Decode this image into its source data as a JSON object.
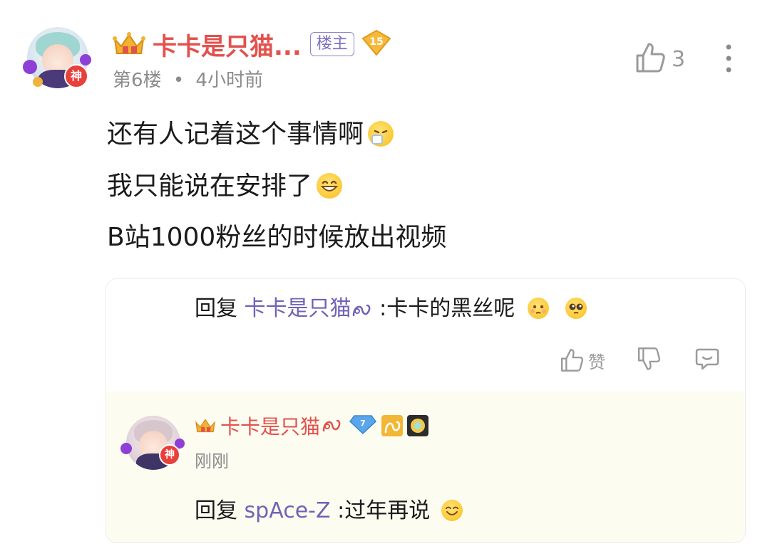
{
  "comment": {
    "username": "卡卡是只猫...",
    "op_badge": "楼主",
    "level": "15",
    "floor": "第6楼",
    "time_separator": "•",
    "time": "4小时前",
    "like_count": "3",
    "avatar_badge": "神",
    "lines": [
      "还有人记着这个事情啊",
      "我只能说在安排了",
      "B站1000粉丝的时候放出视频"
    ],
    "emoji_icons": [
      "sneezing-face-icon",
      "grinning-face-icon"
    ]
  },
  "replies": {
    "first": {
      "prefix": "回复 ",
      "mention": "卡卡是只猫",
      "mention_suffix_icon": "leo-icon",
      "colon_text": " :卡卡的黑丝呢",
      "emoji_icons": [
        "flushed-face-icon",
        "pleading-face-icon"
      ],
      "like_label": "赞"
    },
    "second": {
      "username": "卡卡是只猫",
      "username_suffix_icon": "leo-icon",
      "time": "刚刚",
      "level_badge": "7",
      "avatar_badge": "神",
      "prefix": "回复 ",
      "mention": "spAce-Z",
      "colon_text": " :过年再说",
      "emoji_icons": [
        "smiling-face-icon"
      ]
    }
  },
  "colors": {
    "username": "#e3514c",
    "mention": "#6f63b5",
    "op_badge": "#7a6fbf",
    "reply_highlight_bg": "#fdfcf1",
    "meta_text": "#8c8c8c"
  }
}
